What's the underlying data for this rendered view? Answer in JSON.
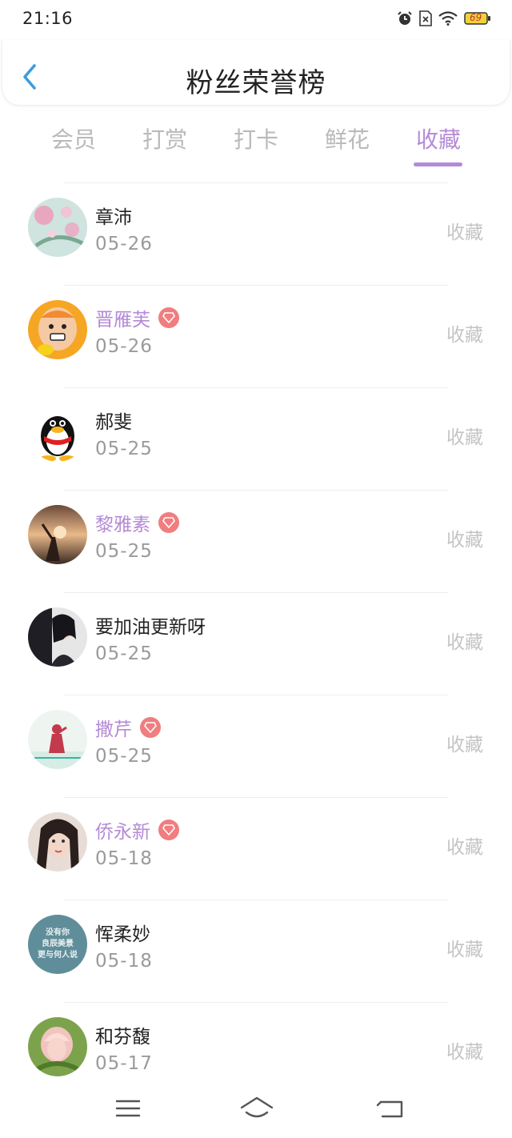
{
  "status_bar": {
    "time": "21:16",
    "battery": "69",
    "icons": [
      "alarm-icon",
      "sim-off-icon",
      "wifi-icon",
      "battery-icon"
    ]
  },
  "header": {
    "title": "粉丝荣誉榜",
    "back_icon": "chevron-left-icon"
  },
  "tabs": [
    {
      "label": "会员",
      "active": false
    },
    {
      "label": "打赏",
      "active": false
    },
    {
      "label": "打卡",
      "active": false
    },
    {
      "label": "鲜花",
      "active": false
    },
    {
      "label": "收藏",
      "active": true
    }
  ],
  "fans": [
    {
      "name": "章沛",
      "date": "05-26",
      "action": "收藏",
      "vip": false
    },
    {
      "name": "晋雁芙",
      "date": "05-26",
      "action": "收藏",
      "vip": true
    },
    {
      "name": "郝斐",
      "date": "05-25",
      "action": "收藏",
      "vip": false
    },
    {
      "name": "黎雅素",
      "date": "05-25",
      "action": "收藏",
      "vip": true
    },
    {
      "name": "要加油更新呀",
      "date": "05-25",
      "action": "收藏",
      "vip": false
    },
    {
      "name": "撒芹",
      "date": "05-25",
      "action": "收藏",
      "vip": true
    },
    {
      "name": "侨永新",
      "date": "05-18",
      "action": "收藏",
      "vip": true
    },
    {
      "name": "恽柔妙",
      "date": "05-18",
      "action": "收藏",
      "vip": false
    },
    {
      "name": "和芬馥",
      "date": "05-17",
      "action": "收藏",
      "vip": false
    }
  ],
  "avatar_8_text": [
    "没有你",
    "良辰美景",
    "更与何人说"
  ],
  "colors": {
    "accent": "#b58ad6",
    "back_arrow": "#3a9be0",
    "vip_badge": "#f07d7f",
    "muted": "#c4c4c4"
  },
  "navbar": {
    "icons": [
      "menu-icon",
      "home-icon",
      "back-icon"
    ]
  }
}
